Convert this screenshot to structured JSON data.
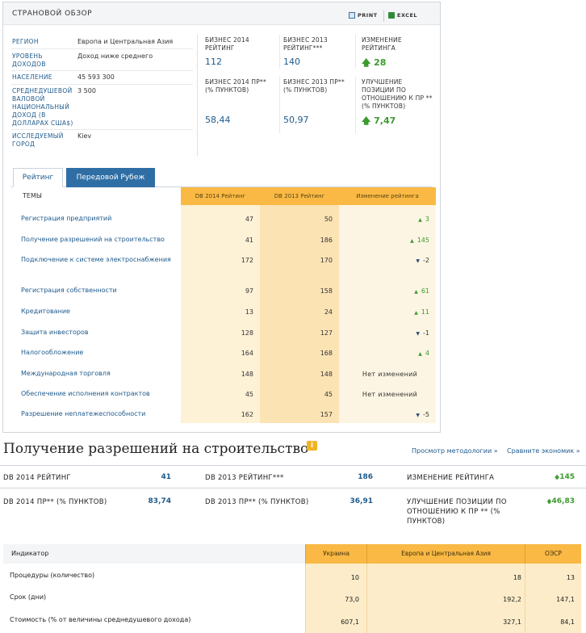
{
  "overview": {
    "title": "СТРАНОВОЙ ОБЗОР",
    "print_label": "PRINT",
    "excel_label": "EXCEL",
    "info": [
      {
        "label": "РЕГИОН",
        "value": "Европа и Центральная Азия"
      },
      {
        "label": "УРОВЕНЬ ДОХОДОВ",
        "value": "Доход ниже среднего"
      },
      {
        "label": "НАСЕЛЕНИЕ",
        "value": "45 593 300"
      },
      {
        "label": "СРЕДНЕДУШЕВОЙ ВАЛОВОЙ НАЦИОНАЛЬНЫЙ ДОХОД (В ДОЛЛАРАХ США$)",
        "value": "3 500"
      },
      {
        "label": "ИССЛЕДУЕМЫЙ ГОРОД",
        "value": "Kiev"
      }
    ],
    "stats": {
      "rank2014_label": "БИЗНЕС 2014 РЕЙТИНГ",
      "rank2014_value": "112",
      "rank2013_label": "БИЗНЕС 2013 РЕЙТИНГ***",
      "rank2013_value": "140",
      "change_label": "ИЗМЕНЕНИЕ РЕЙТИНГА",
      "change_value": "28",
      "dtf2014_label": "БИЗНЕС 2014 ПР** (% ПУНКТОВ)",
      "dtf2014_value": "58,44",
      "dtf2013_label": "БИЗНЕС 2013 ПР** (% ПУНКТОВ)",
      "dtf2013_value": "50,97",
      "improve_label": "УЛУЧШЕНИЕ ПОЗИЦИИ ПО ОТНОШЕНИЮ К ПР ** (% ПУНКТОВ)",
      "improve_value": "7,47"
    }
  },
  "tabs": [
    {
      "label": "Рейтинг",
      "active": true
    },
    {
      "label": "Передовой Рубеж",
      "active": false
    }
  ],
  "rating_table": {
    "headers": [
      "ТЕМЫ",
      "DB 2014 Рейтинг",
      "DB 2013 Рейтинг",
      "Изменение рейтинга"
    ],
    "rows": [
      {
        "topic": "Регистрация предприятий",
        "r2014": "47",
        "r2013": "50",
        "change": "3",
        "dir": "up"
      },
      {
        "topic": "Получение разрешений на строительство",
        "r2014": "41",
        "r2013": "186",
        "change": "145",
        "dir": "up"
      },
      {
        "topic": "Подключение к системе электроснабжения",
        "r2014": "172",
        "r2013": "170",
        "change": "-2",
        "dir": "down"
      },
      {
        "topic": "Регистрация собственности",
        "r2014": "97",
        "r2013": "158",
        "change": "61",
        "dir": "up"
      },
      {
        "topic": "Кредитование",
        "r2014": "13",
        "r2013": "24",
        "change": "11",
        "dir": "up"
      },
      {
        "topic": "Защита инвесторов",
        "r2014": "128",
        "r2013": "127",
        "change": "-1",
        "dir": "down"
      },
      {
        "topic": "Налогообложение",
        "r2014": "164",
        "r2013": "168",
        "change": "4",
        "dir": "up"
      },
      {
        "topic": "Международная торговля",
        "r2014": "148",
        "r2013": "148",
        "change": "Нет изменений",
        "dir": "none"
      },
      {
        "topic": "Обеспечение исполнения контрактов",
        "r2014": "45",
        "r2013": "45",
        "change": "Нет изменений",
        "dir": "none"
      },
      {
        "topic": "Разрешение неплатежеспособности",
        "r2014": "162",
        "r2013": "157",
        "change": "-5",
        "dir": "down"
      }
    ]
  },
  "section": {
    "title": "Получение разрешений на строительство",
    "info_badge": "i",
    "link_methodology": "Просмотр методологии »",
    "link_compare": "Сравните экономик »",
    "stats": {
      "rank2014_label": "DB 2014 РЕЙТИНГ",
      "rank2014_value": "41",
      "rank2013_label": "DB 2013 РЕЙТИНГ***",
      "rank2013_value": "186",
      "change_label": "ИЗМЕНЕНИЕ РЕЙТИНГА",
      "change_value": "145",
      "dtf2014_label": "DB 2014 ПР** (% ПУНКТОВ)",
      "dtf2014_value": "83,74",
      "dtf2013_label": "DB 2013 ПР** (% ПУНКТОВ)",
      "dtf2013_value": "36,91",
      "improve_label": "УЛУЧШЕНИЕ ПОЗИЦИИ ПО ОТНОШЕНИЮ К ПР ** (% ПУНКТОВ)",
      "improve_value": "46,83"
    },
    "indicator_table": {
      "headers": [
        "Индикатор",
        "Украина",
        "Европа и Центральная Азия",
        "ОЭСР"
      ],
      "rows": [
        {
          "name": "Процедуры (количество)",
          "ukraine": "10",
          "eca": "18",
          "oecd": "13"
        },
        {
          "name": "Срок (дни)",
          "ukraine": "73,0",
          "eca": "192,2",
          "oecd": "147,1"
        },
        {
          "name": "Стоимость (% от величины среднедушевого дохода)",
          "ukraine": "607,1",
          "eca": "327,1",
          "oecd": "84,1"
        }
      ]
    }
  },
  "colors": {
    "accent_blue": "#1e5a8c",
    "tab_blue": "#2f6ea5",
    "header_orange": "#f9b944",
    "cell_tint": "#fcecc9",
    "positive_green": "#3c9a2e"
  }
}
